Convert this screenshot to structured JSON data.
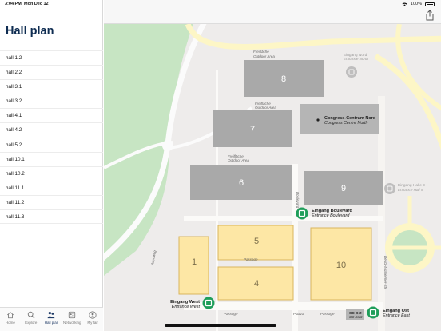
{
  "status": {
    "time": "3:04 PM",
    "date": "Mon Dec 12",
    "battery": "100%"
  },
  "sidebar": {
    "title": "Hall plan",
    "halls": [
      "hall 1.2",
      "hall 2.2",
      "hall 3.1",
      "hall 3.2",
      "hall 4.1",
      "hall 4.2",
      "hall 5.2",
      "hall 10.1",
      "hall 10.2",
      "hall 11.1",
      "hall 11.2",
      "hall 11.3"
    ]
  },
  "tabs": [
    {
      "label": "Home",
      "icon": "home-icon"
    },
    {
      "label": "Explore",
      "icon": "search-icon"
    },
    {
      "label": "Hall plan",
      "icon": "people-icon",
      "active": true
    },
    {
      "label": "Networking",
      "icon": "networking-icon"
    },
    {
      "label": "My fair",
      "icon": "user-icon"
    }
  ],
  "map": {
    "halls": {
      "h8": "8",
      "h7": "7",
      "h6": "6",
      "h9": "9",
      "h5": "5",
      "h1": "1",
      "h4": "4",
      "h10": "10"
    },
    "outdoor": {
      "de": "Freifläche",
      "en": "Outdoor Area"
    },
    "ccn": {
      "de": "Congress-Centrum Nord",
      "en": "Congress Centre North"
    },
    "nord": {
      "de": "Eingang Nord",
      "en": "Entrance North"
    },
    "halle9": {
      "de": "Eingang Halle 9",
      "en": "Entrance Hall 9"
    },
    "boulevard": {
      "de": "Eingang Boulevard",
      "en": "Entrance Boulevard"
    },
    "west": {
      "de": "Eingang West",
      "en": "Entrance West"
    },
    "ost": {
      "de": "Eingang Ost",
      "en": "Entrance East"
    },
    "ccost": {
      "de": "CC Ost",
      "en": "CC East"
    },
    "streets": {
      "boulevard": "Boulevard",
      "passage": "Passage",
      "piazza": "Piazza",
      "deutz": "Deutz-Mülheimer-Str.",
      "auenweg": "Auenweg"
    }
  }
}
